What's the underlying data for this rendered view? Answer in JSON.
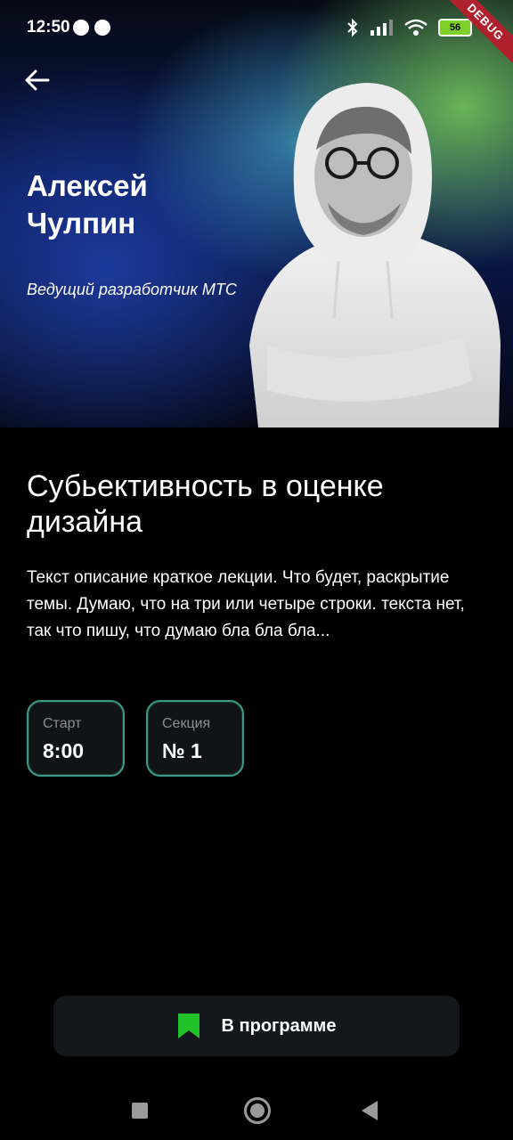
{
  "status_bar": {
    "time": "12:50",
    "battery": "56",
    "debug_banner": "DEBUG"
  },
  "speaker": {
    "name": "Алексей Чулпин",
    "role": "Ведущий разработчик МТС"
  },
  "lecture": {
    "title": "Субьективность в оценке дизайна",
    "description": "Текст описание краткое лекции. Что будет, раскрытие темы. Думаю, что на три или четыре строки. текста нет, так что пишу, что думаю бла бла бла..."
  },
  "chips": [
    {
      "label": "Старт",
      "value": "8:00"
    },
    {
      "label": "Секция",
      "value": "№ 1"
    }
  ],
  "action_button": {
    "label": "В программе",
    "icon": "bookmark-icon",
    "icon_color": "#21c12a"
  },
  "nav": {
    "items": [
      "recents-icon",
      "home-icon",
      "back-icon"
    ]
  },
  "colors": {
    "chip_border": "#3a9a8a",
    "background": "#000000"
  }
}
